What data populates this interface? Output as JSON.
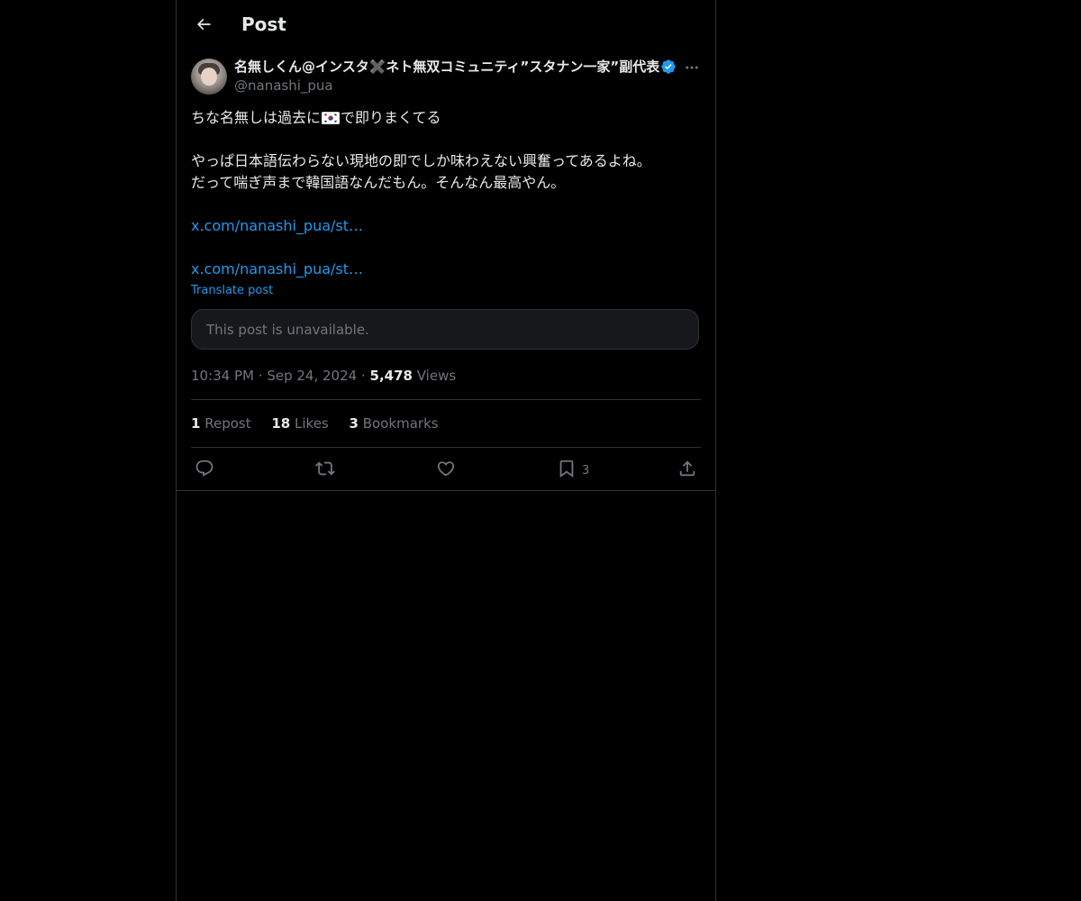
{
  "header": {
    "title": "Post",
    "back_icon": "arrow-left-icon"
  },
  "author": {
    "display_name": "名無しくん@インスタ✖️ネト無双コミュニティ”スタナン一家”副代表",
    "handle": "@nanashi_pua",
    "verified": true,
    "verified_color": "#1d9bf0"
  },
  "post": {
    "line1_before_flag": "ちな名無しは過去に",
    "flag_icon": "south-korea-flag-icon",
    "line1_after_flag": "で即りまくてる",
    "line2": "やっぱ日本語伝わらない現地の即でしか味わえない興奮ってあるよね。",
    "line3": "だって喘ぎ声まで韓国語なんだもん。そんなん最高やん。",
    "link1": "x.com/nanashi_pua/st…",
    "link2": "x.com/nanashi_pua/st…",
    "translate_label": "Translate post",
    "quoted_unavailable": "This post is unavailable."
  },
  "meta": {
    "time": "10:34 PM",
    "separator": "·",
    "date": "Sep 24, 2024",
    "views_count": "5,478",
    "views_label": "Views"
  },
  "stats": {
    "reposts_count": "1",
    "reposts_label": "Repost",
    "likes_count": "18",
    "likes_label": "Likes",
    "bookmarks_count": "3",
    "bookmarks_label": "Bookmarks"
  },
  "actions": {
    "reply_icon": "reply-icon",
    "repost_icon": "repost-icon",
    "like_icon": "heart-icon",
    "bookmark_icon": "bookmark-icon",
    "bookmark_count": "3",
    "share_icon": "share-icon"
  },
  "colors": {
    "background": "#000000",
    "text": "#e7e9ea",
    "muted": "#71767b",
    "accent": "#1d9bf0",
    "border": "#2f3336"
  }
}
